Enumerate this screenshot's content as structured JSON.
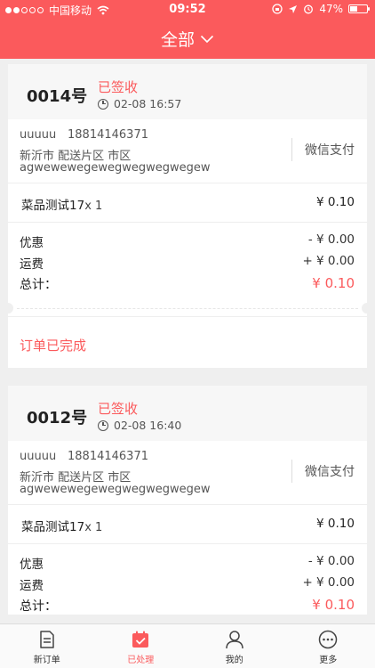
{
  "status_bar": {
    "carrier": "中国移动",
    "time": "09:52",
    "battery": "47%",
    "battery_level": 0.47
  },
  "header": {
    "title": "全部"
  },
  "orders": [
    {
      "number": "0014号",
      "status": "已签收",
      "time": "02-08 16:57",
      "customer_name": "uuuuu",
      "phone": "18814146371",
      "address_line1": "新沂市 配送片区 市区",
      "address_line2": "agwewewegewegwegwegwegew",
      "payment": "微信支付",
      "item_name": "菜品测试17",
      "item_qty": "x 1",
      "item_price": "¥  0.10",
      "discount_label": "优惠",
      "discount_value": "- ¥ 0.00",
      "shipping_label": "运费",
      "shipping_value": "+ ¥ 0.00",
      "total_label": "总计：",
      "total_value": "¥ 0.10",
      "footer_status": "订单已完成"
    },
    {
      "number": "0012号",
      "status": "已签收",
      "time": "02-08 16:40",
      "customer_name": "uuuuu",
      "phone": "18814146371",
      "address_line1": "新沂市 配送片区 市区",
      "address_line2": "agwewewegewegwegwegwegew",
      "payment": "微信支付",
      "item_name": "菜品测试17",
      "item_qty": "x 1",
      "item_price": "¥  0.10",
      "discount_label": "优惠",
      "discount_value": "- ¥ 0.00",
      "shipping_label": "运费",
      "shipping_value": "+ ¥ 0.00",
      "total_label": "总计：",
      "total_value": "¥ 0.10"
    }
  ],
  "tabs": [
    {
      "label": "新订单",
      "icon": "document-icon",
      "active": false
    },
    {
      "label": "已处理",
      "icon": "calendar-check-icon",
      "active": true
    },
    {
      "label": "我的",
      "icon": "person-icon",
      "active": false
    },
    {
      "label": "更多",
      "icon": "more-icon",
      "active": false
    }
  ],
  "colors": {
    "accent": "#fb5a5c",
    "background": "#efefef"
  }
}
